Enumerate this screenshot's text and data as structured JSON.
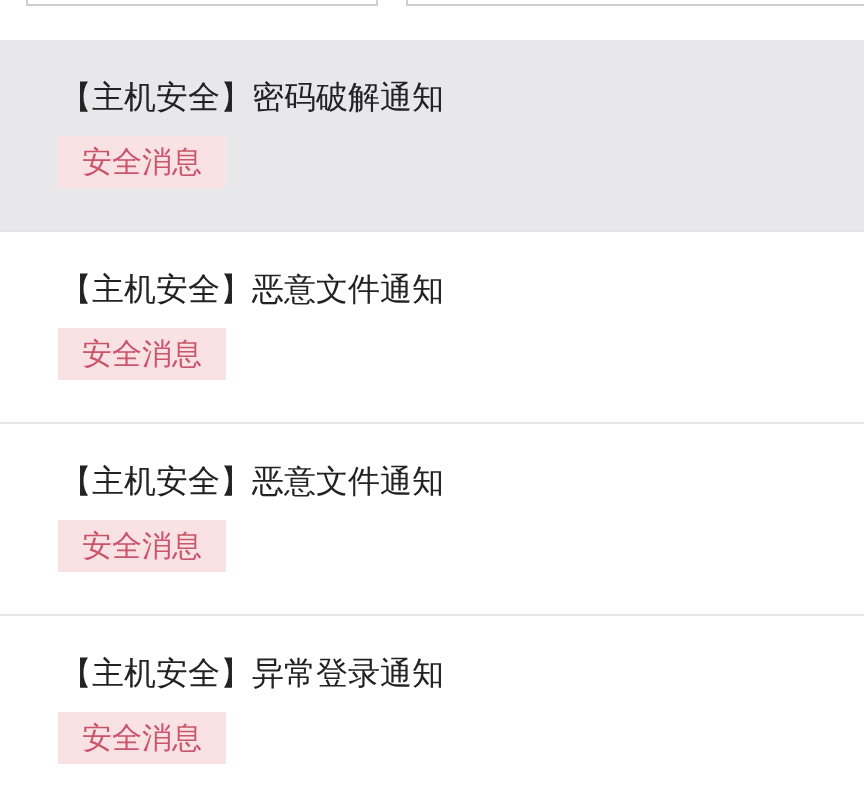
{
  "notifications": [
    {
      "title": "【主机安全】密码破解通知",
      "tag": "安全消息",
      "selected": true
    },
    {
      "title": "【主机安全】恶意文件通知",
      "tag": "安全消息",
      "selected": false
    },
    {
      "title": "【主机安全】恶意文件通知",
      "tag": "安全消息",
      "selected": false
    },
    {
      "title": "【主机安全】异常登录通知",
      "tag": "安全消息",
      "selected": false
    }
  ]
}
